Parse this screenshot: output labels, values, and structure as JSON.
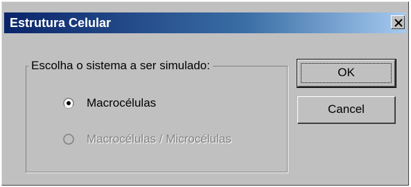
{
  "window": {
    "title": "Estrutura Celular"
  },
  "group": {
    "label": "Escolha o sistema a ser simulado:",
    "options": [
      {
        "label": "Macrocélulas",
        "selected": true,
        "enabled": true
      },
      {
        "label": "Macrocélulas / Microcélulas",
        "selected": false,
        "enabled": false
      }
    ]
  },
  "buttons": {
    "ok": "OK",
    "cancel": "Cancel"
  },
  "colors": {
    "titlebar_start": "#0a246a",
    "titlebar_end": "#a6caf0",
    "face": "#c0c0c0"
  }
}
